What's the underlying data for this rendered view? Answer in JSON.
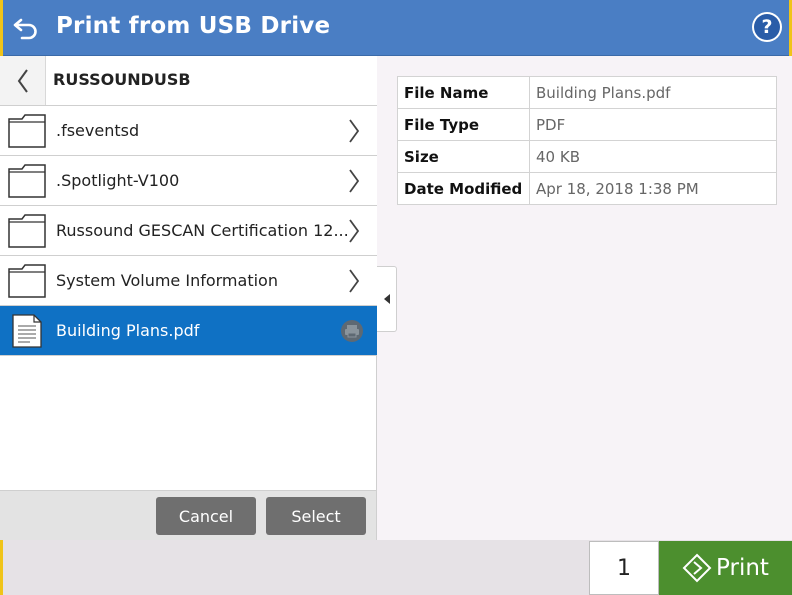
{
  "header": {
    "title": "Print from USB Drive",
    "help_glyph": "?"
  },
  "breadcrumb": {
    "label": "RUSSOUNDUSB"
  },
  "files": [
    {
      "label": ".fseventsd",
      "icon": "folder-icon"
    },
    {
      "label": ".Spotlight-V100",
      "icon": "folder-icon"
    },
    {
      "label": "Russound GESCAN Certification 12...",
      "icon": "folder-icon"
    },
    {
      "label": "System Volume Information",
      "icon": "folder-icon"
    },
    {
      "label": "Building Plans.pdf",
      "icon": "document-icon",
      "selected": true
    }
  ],
  "actions": {
    "cancel_label": "Cancel",
    "select_label": "Select"
  },
  "details": {
    "rows": [
      {
        "key": "File Name",
        "value": "Building Plans.pdf"
      },
      {
        "key": "File Type",
        "value": "PDF"
      },
      {
        "key": "Size",
        "value": "40 KB"
      },
      {
        "key": "Date Modified",
        "value": "Apr 18, 2018 1:38 PM"
      }
    ]
  },
  "footer": {
    "copies": "1",
    "print_label": "Print"
  },
  "colors": {
    "header": "#4a7ec4",
    "selection": "#0f71c4",
    "print": "#4c8f2e",
    "accent": "#f0c419"
  }
}
